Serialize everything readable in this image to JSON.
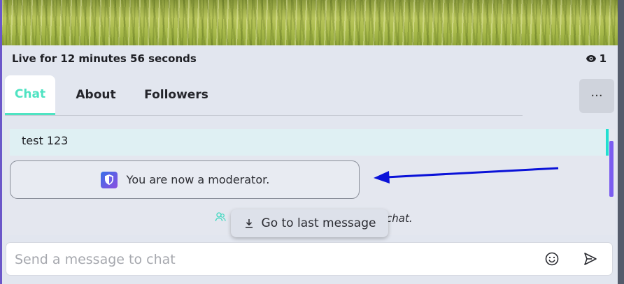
{
  "stream": {
    "live_text": "Live for 12 minutes 56 seconds",
    "viewer_count": "1"
  },
  "tabs": [
    {
      "label": "Chat",
      "active": true
    },
    {
      "label": "About",
      "active": false
    },
    {
      "label": "Followers",
      "active": false
    }
  ],
  "more_menu": {
    "icon": "ellipsis-icon",
    "label": "···"
  },
  "chat": {
    "messages": [
      {
        "text": "test 123"
      }
    ],
    "system_notice": "You are now a moderator.",
    "joined_notice_tail": "chat.",
    "goto_last_label": "Go to last message"
  },
  "input": {
    "placeholder": "Send a message to chat"
  },
  "colors": {
    "accent_teal": "#4fe3c2",
    "moderator_purple": "#7b5df0",
    "annotation_arrow": "#0a12d8"
  }
}
